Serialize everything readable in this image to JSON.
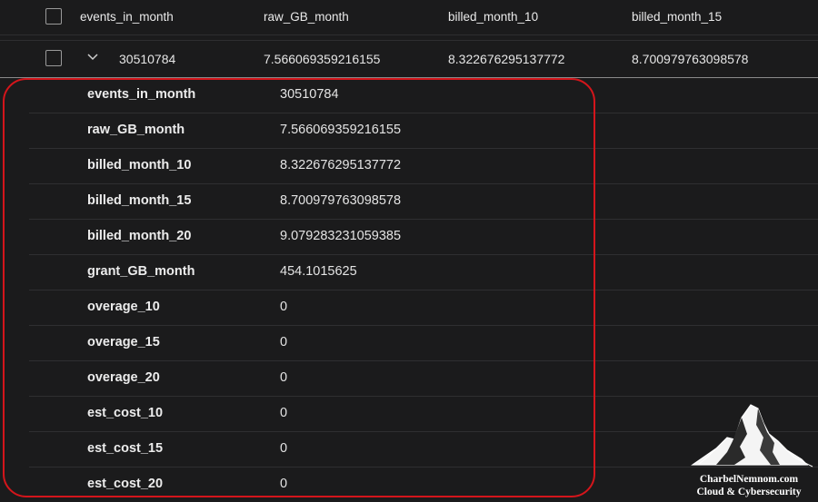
{
  "header": {
    "columns": [
      "events_in_month",
      "raw_GB_month",
      "billed_month_10",
      "billed_month_15"
    ]
  },
  "row": {
    "values": [
      "30510784",
      "7.566069359216155",
      "8.322676295137772",
      "8.700979763098578"
    ]
  },
  "details": [
    {
      "key": "events_in_month",
      "value": "30510784"
    },
    {
      "key": "raw_GB_month",
      "value": "7.566069359216155"
    },
    {
      "key": "billed_month_10",
      "value": "8.322676295137772"
    },
    {
      "key": "billed_month_15",
      "value": "8.700979763098578"
    },
    {
      "key": "billed_month_20",
      "value": "9.079283231059385"
    },
    {
      "key": "grant_GB_month",
      "value": "454.1015625"
    },
    {
      "key": "overage_10",
      "value": "0"
    },
    {
      "key": "overage_15",
      "value": "0"
    },
    {
      "key": "overage_20",
      "value": "0"
    },
    {
      "key": "est_cost_10",
      "value": "0"
    },
    {
      "key": "est_cost_15",
      "value": "0"
    },
    {
      "key": "est_cost_20",
      "value": "0"
    }
  ],
  "highlight_color": "#d4151b",
  "watermark": {
    "line1": "CharbelNemnom.com",
    "line2": "Cloud & Cybersecurity"
  },
  "icons": {
    "select_all": "checkbox-icon",
    "row_select": "checkbox-icon",
    "expand": "chevron-down-icon",
    "logo": "mountain-logo-icon"
  }
}
